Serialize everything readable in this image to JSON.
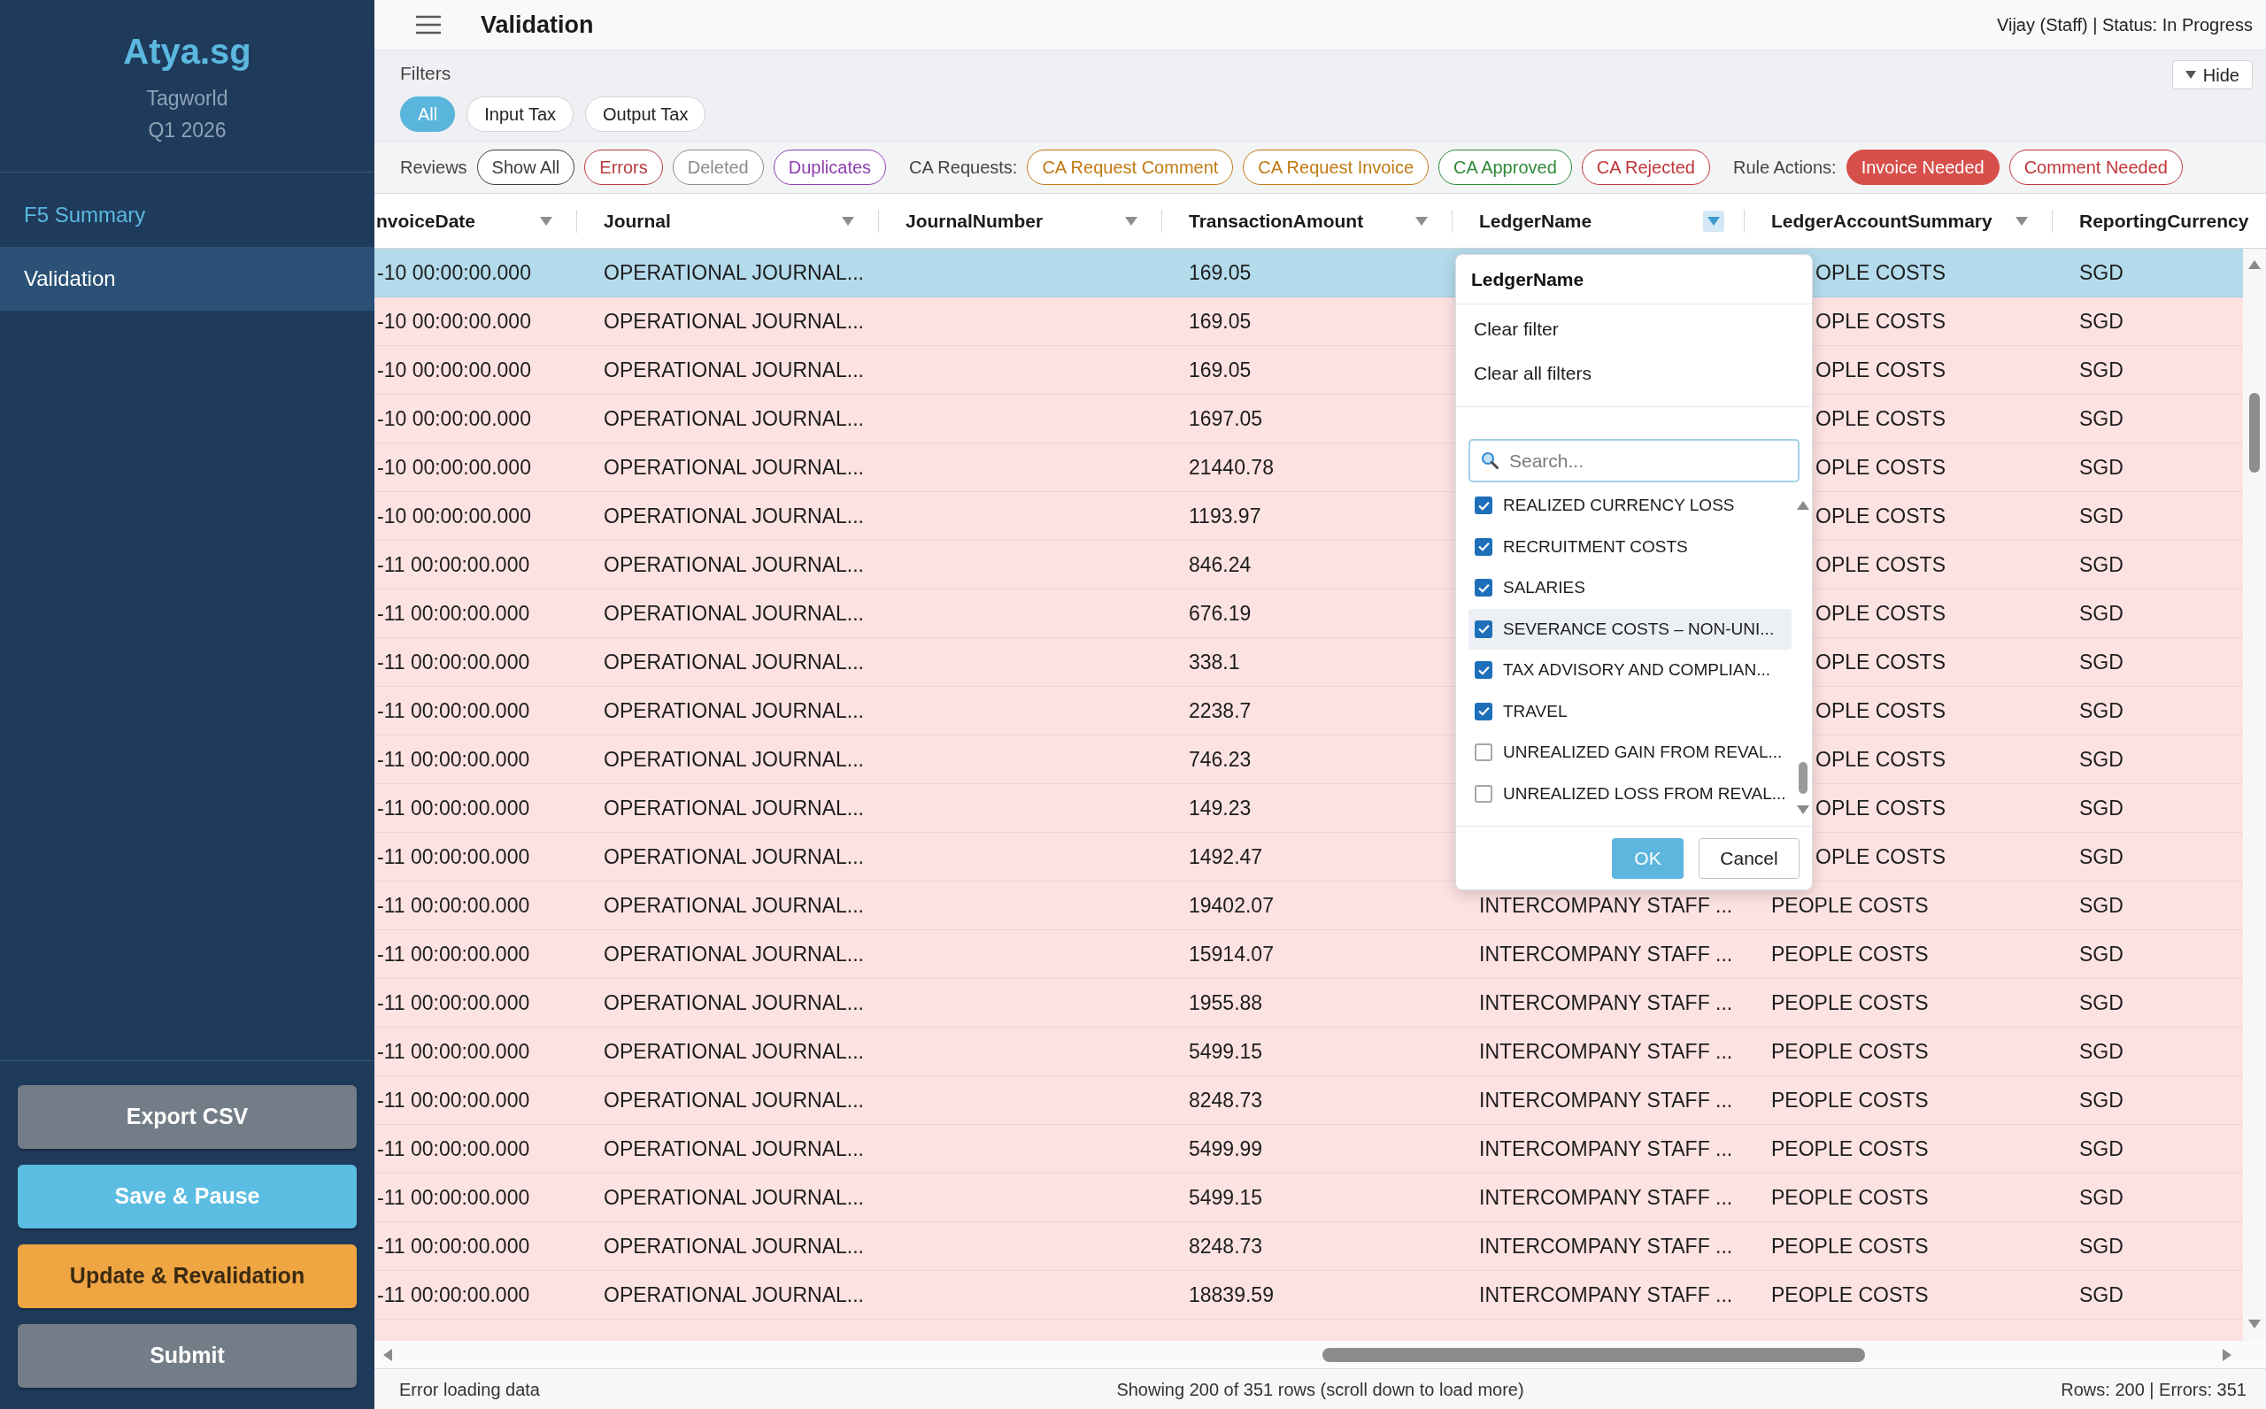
{
  "sidebar": {
    "logo": "Atya.sg",
    "company": "Tagworld",
    "period": "Q1 2026",
    "nav": [
      {
        "label": "F5 Summary",
        "selected": false
      },
      {
        "label": "Validation",
        "selected": true
      }
    ],
    "actions": [
      {
        "label": "Export CSV",
        "kind": "secondary"
      },
      {
        "label": "Save & Pause",
        "kind": "primary"
      },
      {
        "label": "Update & Revalidation",
        "kind": "warning"
      },
      {
        "label": "Submit",
        "kind": "secondary"
      }
    ]
  },
  "header": {
    "title": "Validation",
    "user_status": "Vijay (Staff) | Status: In Progress"
  },
  "filters": {
    "label": "Filters",
    "hide_button": "Hide",
    "tax_types": [
      {
        "label": "All",
        "selected": true
      },
      {
        "label": "Input Tax",
        "selected": false
      },
      {
        "label": "Output Tax",
        "selected": false
      }
    ]
  },
  "toolbar": {
    "groups": [
      {
        "label": "Reviews",
        "chips": [
          {
            "label": "Show All",
            "color": "#3d3d3d",
            "selected": false
          },
          {
            "label": "Errors",
            "color": "#b83b3b",
            "selected": false
          },
          {
            "label": "Deleted",
            "color": "#8c8c8c",
            "selected": false
          },
          {
            "label": "Duplicates",
            "color": "#8e3fb0",
            "selected": false
          }
        ]
      },
      {
        "label": "CA Requests:",
        "chips": [
          {
            "label": "CA Request Comment",
            "color": "#c07a12",
            "selected": false
          },
          {
            "label": "CA Request Invoice",
            "color": "#c07a12",
            "selected": false
          },
          {
            "label": "CA Approved",
            "color": "#2f8a3a",
            "selected": false
          },
          {
            "label": "CA Rejected",
            "color": "#c0353a",
            "selected": false
          }
        ]
      },
      {
        "label": "Rule Actions:",
        "chips": [
          {
            "label": "Invoice Needed",
            "color": "#d64f4a",
            "selected": true
          },
          {
            "label": "Comment Needed",
            "color": "#c0353a",
            "selected": false
          }
        ]
      }
    ]
  },
  "table": {
    "columns": [
      {
        "label": "nvoiceDate",
        "filter_active": false
      },
      {
        "label": "Journal",
        "filter_active": false
      },
      {
        "label": "JournalNumber",
        "filter_active": false
      },
      {
        "label": "TransactionAmount",
        "filter_active": false
      },
      {
        "label": "LedgerName",
        "filter_active": true
      },
      {
        "label": "LedgerAccountSummary",
        "filter_active": false
      },
      {
        "label": "ReportingCurrency"
      }
    ],
    "filter_popup": {
      "title": "LedgerName",
      "actions": [
        "Clear filter",
        "Clear all filters"
      ],
      "search": {
        "placeholder": "Search..."
      },
      "options": [
        {
          "label": "REALIZED CURRENCY LOSS",
          "checked": true,
          "highlighted": false
        },
        {
          "label": "RECRUITMENT COSTS",
          "checked": true,
          "highlighted": false
        },
        {
          "label": "SALARIES",
          "checked": true,
          "highlighted": false
        },
        {
          "label": "SEVERANCE COSTS – NON-UNI...",
          "checked": true,
          "highlighted": true
        },
        {
          "label": "TAX ADVISORY AND COMPLIAN...",
          "checked": true,
          "highlighted": false
        },
        {
          "label": "TRAVEL",
          "checked": true,
          "highlighted": false
        },
        {
          "label": "UNREALIZED GAIN FROM REVAL...",
          "checked": false,
          "highlighted": false
        },
        {
          "label": "UNREALIZED LOSS FROM REVAL...",
          "checked": false,
          "highlighted": false
        }
      ],
      "ok": "OK",
      "cancel": "Cancel"
    },
    "rows": [
      {
        "selected": true,
        "column_1": "-10 00:00:00.000",
        "journal": "OPERATIONAL JOURNAL...",
        "transaction_amount": "169.05",
        "ledger_account_summary": "OPLE COSTS",
        "reporting_currency": "SGD"
      },
      {
        "selected": false,
        "column_1": "-10 00:00:00.000",
        "journal": "OPERATIONAL JOURNAL...",
        "transaction_amount": "169.05",
        "ledger_account_summary": "OPLE COSTS",
        "reporting_currency": "SGD"
      },
      {
        "selected": false,
        "column_1": "-10 00:00:00.000",
        "journal": "OPERATIONAL JOURNAL...",
        "transaction_amount": "169.05",
        "ledger_account_summary": "OPLE COSTS",
        "reporting_currency": "SGD"
      },
      {
        "selected": false,
        "column_1": "-10 00:00:00.000",
        "journal": "OPERATIONAL JOURNAL...",
        "transaction_amount": "1697.05",
        "ledger_account_summary": "OPLE COSTS",
        "reporting_currency": "SGD"
      },
      {
        "selected": false,
        "column_1": "-10 00:00:00.000",
        "journal": "OPERATIONAL JOURNAL...",
        "transaction_amount": "21440.78",
        "ledger_account_summary": "OPLE COSTS",
        "reporting_currency": "SGD"
      },
      {
        "selected": false,
        "column_1": "-10 00:00:00.000",
        "journal": "OPERATIONAL JOURNAL...",
        "transaction_amount": "1193.97",
        "ledger_account_summary": "OPLE COSTS",
        "reporting_currency": "SGD"
      },
      {
        "selected": false,
        "column_1": "-11 00:00:00.000",
        "journal": "OPERATIONAL JOURNAL...",
        "transaction_amount": "846.24",
        "ledger_account_summary": "OPLE COSTS",
        "reporting_currency": "SGD"
      },
      {
        "selected": false,
        "column_1": "-11 00:00:00.000",
        "journal": "OPERATIONAL JOURNAL...",
        "transaction_amount": "676.19",
        "ledger_account_summary": "OPLE COSTS",
        "reporting_currency": "SGD"
      },
      {
        "selected": false,
        "column_1": "-11 00:00:00.000",
        "journal": "OPERATIONAL JOURNAL...",
        "transaction_amount": "338.1",
        "ledger_account_summary": "OPLE COSTS",
        "reporting_currency": "SGD"
      },
      {
        "selected": false,
        "column_1": "-11 00:00:00.000",
        "journal": "OPERATIONAL JOURNAL...",
        "transaction_amount": "2238.7",
        "ledger_account_summary": "OPLE COSTS",
        "reporting_currency": "SGD"
      },
      {
        "selected": false,
        "column_1": "-11 00:00:00.000",
        "journal": "OPERATIONAL JOURNAL...",
        "transaction_amount": "746.23",
        "ledger_account_summary": "OPLE COSTS",
        "reporting_currency": "SGD"
      },
      {
        "selected": false,
        "column_1": "-11 00:00:00.000",
        "journal": "OPERATIONAL JOURNAL...",
        "transaction_amount": "149.23",
        "ledger_account_summary": "OPLE COSTS",
        "reporting_currency": "SGD"
      },
      {
        "selected": false,
        "column_1": "-11 00:00:00.000",
        "journal": "OPERATIONAL JOURNAL...",
        "transaction_amount": "1492.47",
        "ledger_account_summary": "OPLE COSTS",
        "reporting_currency": "SGD"
      },
      {
        "selected": false,
        "column_1": "-11 00:00:00.000",
        "journal": "OPERATIONAL JOURNAL...",
        "transaction_amount": "19402.07",
        "ledger_name": "INTERCOMPANY STAFF ...",
        "ledger_account_summary": "PEOPLE COSTS",
        "reporting_currency": "SGD"
      },
      {
        "selected": false,
        "column_1": "-11 00:00:00.000",
        "journal": "OPERATIONAL JOURNAL...",
        "transaction_amount": "15914.07",
        "ledger_name": "INTERCOMPANY STAFF ...",
        "ledger_account_summary": "PEOPLE COSTS",
        "reporting_currency": "SGD"
      },
      {
        "selected": false,
        "column_1": "-11 00:00:00.000",
        "journal": "OPERATIONAL JOURNAL...",
        "transaction_amount": "1955.88",
        "ledger_name": "INTERCOMPANY STAFF ...",
        "ledger_account_summary": "PEOPLE COSTS",
        "reporting_currency": "SGD"
      },
      {
        "selected": false,
        "column_1": "-11 00:00:00.000",
        "journal": "OPERATIONAL JOURNAL...",
        "transaction_amount": "5499.15",
        "ledger_name": "INTERCOMPANY STAFF ...",
        "ledger_account_summary": "PEOPLE COSTS",
        "reporting_currency": "SGD"
      },
      {
        "selected": false,
        "column_1": "-11 00:00:00.000",
        "journal": "OPERATIONAL JOURNAL...",
        "transaction_amount": "8248.73",
        "ledger_name": "INTERCOMPANY STAFF ...",
        "ledger_account_summary": "PEOPLE COSTS",
        "reporting_currency": "SGD"
      },
      {
        "selected": false,
        "column_1": "-11 00:00:00.000",
        "journal": "OPERATIONAL JOURNAL...",
        "transaction_amount": "5499.99",
        "ledger_name": "INTERCOMPANY STAFF ...",
        "ledger_account_summary": "PEOPLE COSTS",
        "reporting_currency": "SGD"
      },
      {
        "selected": false,
        "column_1": "-11 00:00:00.000",
        "journal": "OPERATIONAL JOURNAL...",
        "transaction_amount": "5499.15",
        "ledger_name": "INTERCOMPANY STAFF ...",
        "ledger_account_summary": "PEOPLE COSTS",
        "reporting_currency": "SGD"
      },
      {
        "selected": false,
        "column_1": "-11 00:00:00.000",
        "journal": "OPERATIONAL JOURNAL...",
        "transaction_amount": "8248.73",
        "ledger_name": "INTERCOMPANY STAFF ...",
        "ledger_account_summary": "PEOPLE COSTS",
        "reporting_currency": "SGD"
      },
      {
        "selected": false,
        "column_1": "-11 00:00:00.000",
        "journal": "OPERATIONAL JOURNAL...",
        "transaction_amount": "18839.59",
        "ledger_name": "INTERCOMPANY STAFF ...",
        "ledger_account_summary": "PEOPLE COSTS",
        "reporting_currency": "SGD"
      }
    ]
  },
  "status_bar": {
    "message": "Error loading data",
    "summary": "Showing 200 of 351 rows (scroll down to load more)",
    "counts": "Rows: 200 | Errors: 351"
  }
}
